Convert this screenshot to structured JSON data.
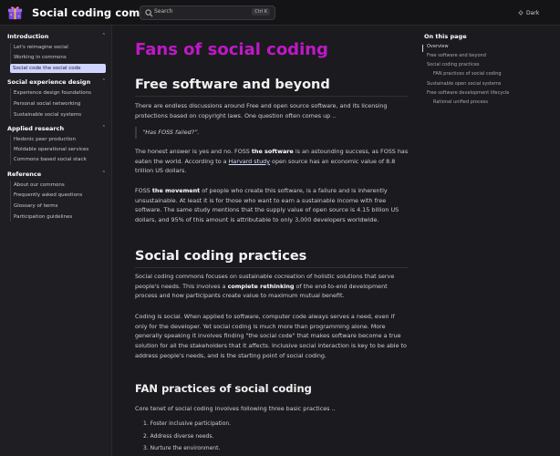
{
  "header": {
    "site_title": "Social coding commons",
    "search_placeholder": "Search",
    "search_shortcut": "Ctrl K",
    "theme_label": "Dark"
  },
  "sidebar": {
    "sections": [
      {
        "title": "Introduction",
        "items": [
          "Let's reimagine social",
          "Working in commons",
          "Social code the social code"
        ]
      },
      {
        "title": "Social experience design",
        "items": [
          "Experience design foundations",
          "Personal social networking",
          "Sustainable social systems"
        ]
      },
      {
        "title": "Applied research",
        "items": [
          "Hedonic peer production",
          "Moldable operational services",
          "Commons based social stack"
        ]
      },
      {
        "title": "Reference",
        "items": [
          "About our commons",
          "Frequently asked questions",
          "Glossary of terms",
          "Participation guidelines"
        ]
      }
    ],
    "active_item": "Social code the social code"
  },
  "main": {
    "page_title": "Fans of social coding",
    "h2_free": "Free software and beyond",
    "p1": "There are endless discussions around Free and open source software, and its licensing protections based on copyright laws. One question often comes up ..",
    "quote": "“Has FOSS failed?”.",
    "p2_a": "The honest answer is yes and no. FOSS ",
    "p2_b": "the software",
    "p2_c": " is an astounding success, as FOSS has eaten the world. According to a ",
    "p2_link": "Harvard study",
    "p2_d": " open source has an economic value of 8.8 trillion US dollars.",
    "p3_a": "FOSS ",
    "p3_b": "the movement",
    "p3_c": " of people who create this software, is a failure and is inherently unsustainable. At least it is for those who want to earn a sustainable income with free software. The same study mentions that the supply value of open source is 4.15 billion US dollars, and 95% of this amount is attributable to only 3,000 developers worldwide.",
    "h2_practices": "Social coding practices",
    "p4_a": "Social coding commons focuses on sustainable cocreation of holistic solutions that serve people's needs. This involves a ",
    "p4_b": "complete rethinking",
    "p4_c": " of the end-to-end development process and how participants create value to maximum mutual benefit.",
    "p5": "Coding is social. When applied to software, computer code always serves a need, even if only for the developer. Yet social coding is much more than programming alone. More generally speaking it involves finding \"the social code\" that makes software become a true solution for all the stakeholders that it affects. Inclusive social interaction is key to be able to address people's needs, and is the starting point of social coding.",
    "h3_fan": "FAN practices of social coding",
    "p6": "Core tenet of social coding involves following three basic practices ..",
    "practices": [
      "1. Foster inclusive participation.",
      "2. Address diverse needs.",
      "3. Nurture the environment."
    ]
  },
  "toc": {
    "title": "On this page",
    "items": [
      "Overview",
      "Free software and beyond",
      "Social coding practices",
      "FAN practices of social coding",
      "Sustainable open social systems",
      "Free software development lifecycle",
      "Rational unified process"
    ]
  }
}
